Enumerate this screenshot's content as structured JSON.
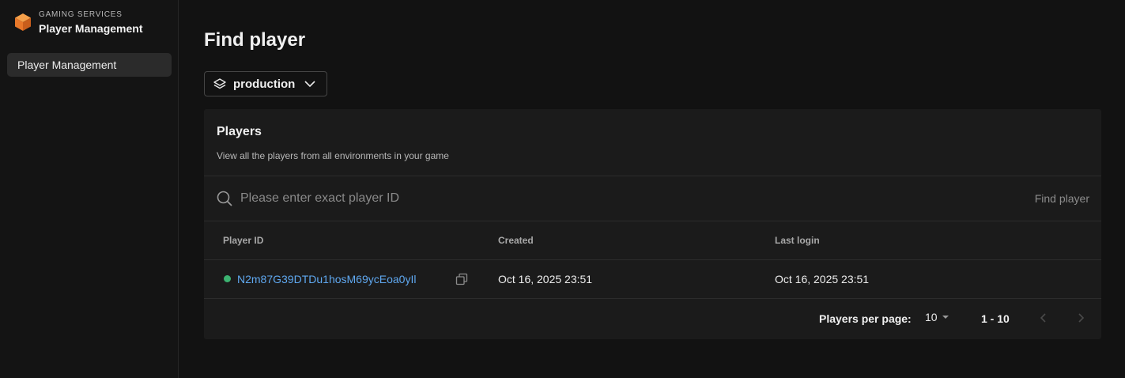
{
  "brand": {
    "kicker": "GAMING SERVICES",
    "title": "Player Management"
  },
  "sidebar": {
    "items": [
      {
        "label": "Player Management",
        "active": true
      }
    ]
  },
  "page": {
    "title": "Find player"
  },
  "environment": {
    "selected": "production"
  },
  "card": {
    "title": "Players",
    "description": "View all the players from all environments in your game"
  },
  "search": {
    "placeholder": "Please enter exact player ID",
    "button_label": "Find player"
  },
  "table": {
    "headers": {
      "player_id": "Player ID",
      "created": "Created",
      "last_login": "Last login"
    },
    "rows": [
      {
        "player_id": "N2m87G39DTDu1hosM69ycEoa0yIl",
        "created": "Oct 16, 2025 23:51",
        "last_login": "Oct 16, 2025 23:51",
        "status_color": "#3cb371"
      }
    ]
  },
  "pagination": {
    "per_page_label": "Players per page:",
    "per_page_value": "10",
    "range": "1 - 10"
  },
  "colors": {
    "accent_link": "#5fa8f0",
    "status_online": "#3cb371",
    "brand_orange": "#f07c2a"
  }
}
